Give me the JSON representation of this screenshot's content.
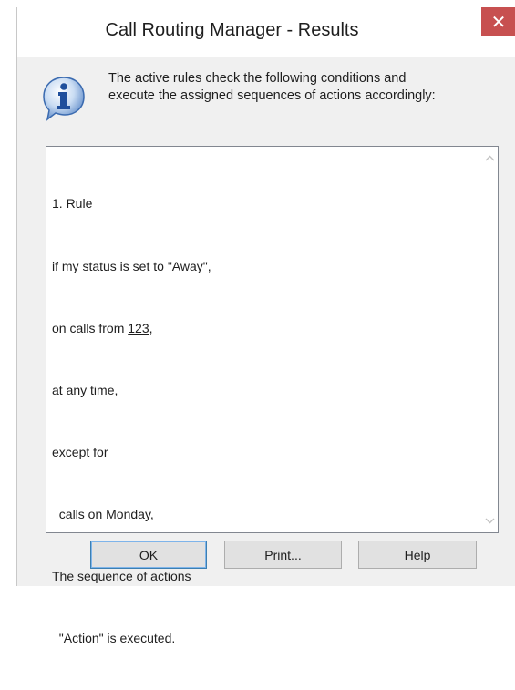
{
  "window": {
    "title": "Call Routing Manager - Results",
    "close_glyph": "✕"
  },
  "info": {
    "icon": "info-icon",
    "text_line1": "The active rules check the following conditions and",
    "text_line2": "execute the assigned sequences of actions accordingly:"
  },
  "rules": {
    "lines": [
      {
        "pre": "1. Rule",
        "link": "",
        "post": ""
      },
      {
        "pre": "if my status is set to \"Away\",",
        "link": "",
        "post": ""
      },
      {
        "pre": "on calls from ",
        "link": "123",
        "post": ","
      },
      {
        "pre": "at any time,",
        "link": "",
        "post": ""
      },
      {
        "pre": "except for",
        "link": "",
        "post": ""
      },
      {
        "pre": "  calls on ",
        "link": "Monday",
        "post": ","
      },
      {
        "pre": "The sequence of actions",
        "link": "",
        "post": ""
      },
      {
        "pre": "  \"",
        "link": "Action",
        "post": "\" is executed."
      }
    ]
  },
  "buttons": {
    "ok": "OK",
    "print": "Print...",
    "help": "Help"
  },
  "colors": {
    "close_button": "#c75050",
    "dialog_background": "#f0f0f0",
    "default_button_border": "#3c7fb1"
  }
}
